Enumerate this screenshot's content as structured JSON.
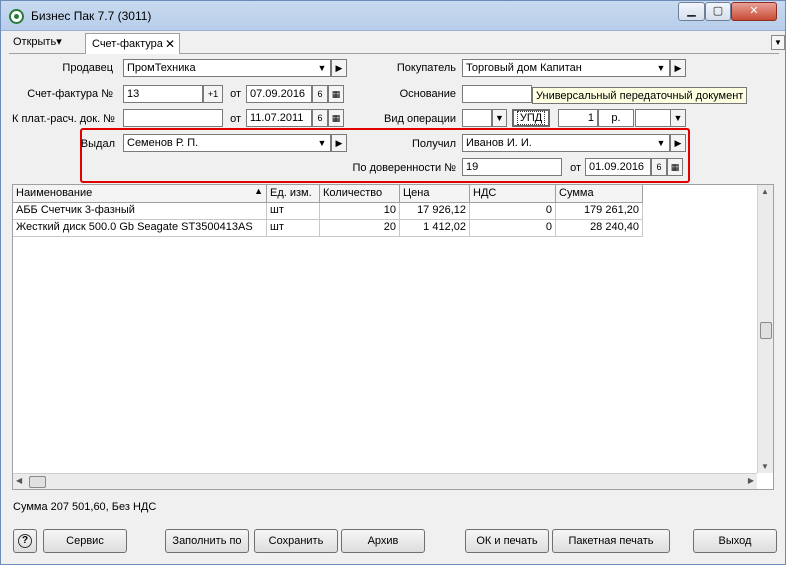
{
  "window": {
    "title": "Бизнес Пак 7.7 (3011)"
  },
  "tabs": {
    "open_label": "Открыть▾",
    "active_label": "Счет-фактура",
    "close_glyph": "✕",
    "menu_glyph": "▼"
  },
  "form": {
    "seller": {
      "label": "Продавец",
      "value": "ПромТехника"
    },
    "buyer": {
      "label": "Покупатель",
      "value": "Торговый дом Капитан"
    },
    "invoice": {
      "label": "Счет-фактура №",
      "value": "13",
      "plus_btn": "+1",
      "from_label": "от",
      "date": "07.09.2016",
      "day_btn": "6"
    },
    "basis": {
      "label": "Основание",
      "value": ""
    },
    "payment_doc": {
      "label": "К плат.-расч. док. №",
      "value": "",
      "from_label": "от",
      "date": "11.07.2011",
      "day_btn": "6"
    },
    "operation": {
      "label": "Вид операции",
      "type_value": "",
      "upd_label": "УПД",
      "qty": "1",
      "unit": "р.",
      "extra": ""
    },
    "tooltip": "Универсальный передаточный документ",
    "issued": {
      "label": "Выдал",
      "value": "Семенов Р. П."
    },
    "received": {
      "label": "Получил",
      "value": "Иванов И. И."
    },
    "proxy": {
      "label": "По доверенности №",
      "value": "19",
      "from_label": "от",
      "date": "01.09.2016",
      "day_btn": "6"
    }
  },
  "grid": {
    "columns": [
      "Наименование",
      "Ед. изм.",
      "Количество",
      "Цена",
      "НДС",
      "Сумма"
    ],
    "sort_glyph": "▲",
    "rows": [
      [
        "АББ Счетчик 3-фазный",
        "шт",
        "10",
        "17 926,12",
        "0",
        "179 261,20"
      ],
      [
        "Жесткий диск 500.0 Gb Seagate ST3500413AS",
        "шт",
        "20",
        "1 412,02",
        "0",
        "28 240,40"
      ]
    ]
  },
  "status": "Сумма 207 501,60, Без НДС",
  "buttons": {
    "help": "?",
    "service": "Сервис",
    "fill": "Заполнить по",
    "save": "Сохранить",
    "archive": "Архив",
    "ok_print": "ОК и печать",
    "batch_print": "Пакетная печать",
    "exit": "Выход"
  },
  "glyphs": {
    "arrow_down": "▼",
    "arrow_right": "▶",
    "calendar": "▦"
  }
}
